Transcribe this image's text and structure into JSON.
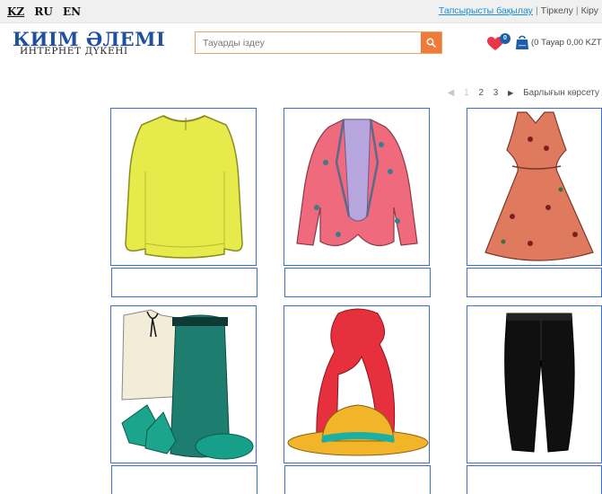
{
  "languages": [
    {
      "code": "KZ",
      "active": true
    },
    {
      "code": "RU",
      "active": false
    },
    {
      "code": "EN",
      "active": false
    }
  ],
  "top_links": {
    "track_order": "Тапсырысты бақылау",
    "register": "Тіркелу",
    "login": "Кіру",
    "separator": "|"
  },
  "logo": {
    "title": "КИІМ ӘЛЕМІ",
    "subtitle": "ИНТЕРНЕТ ДҮКЕНІ"
  },
  "search": {
    "placeholder": "Тауарды іздеу",
    "value": ""
  },
  "header_icons": {
    "wishlist_icon": "heart-icon",
    "wishlist_count": "0",
    "cart_icon": "shopping-bag-icon",
    "cart_summary": "(0 Тауар 0,00 KZT)"
  },
  "pagination": {
    "prev_arrow": "◀",
    "pages": [
      "1",
      "2",
      "3"
    ],
    "next_arrow": "▶",
    "show_all": "Барлығын көрсету"
  },
  "products": [
    {
      "image": "yellow-sweater",
      "caption": ""
    },
    {
      "image": "pink-jacket",
      "caption": ""
    },
    {
      "image": "floral-dress",
      "caption": ""
    },
    {
      "image": "outfit-set-skirt-shoes",
      "caption": ""
    },
    {
      "image": "red-scarf-and-hat",
      "caption": ""
    },
    {
      "image": "black-trousers",
      "caption": ""
    }
  ],
  "colors": {
    "accent_orange": "#f07a3a",
    "link_blue": "#1a8fd6",
    "logo_blue": "#1e4fa3",
    "card_border": "#3d6fd0",
    "heart_red": "#e8364a"
  }
}
